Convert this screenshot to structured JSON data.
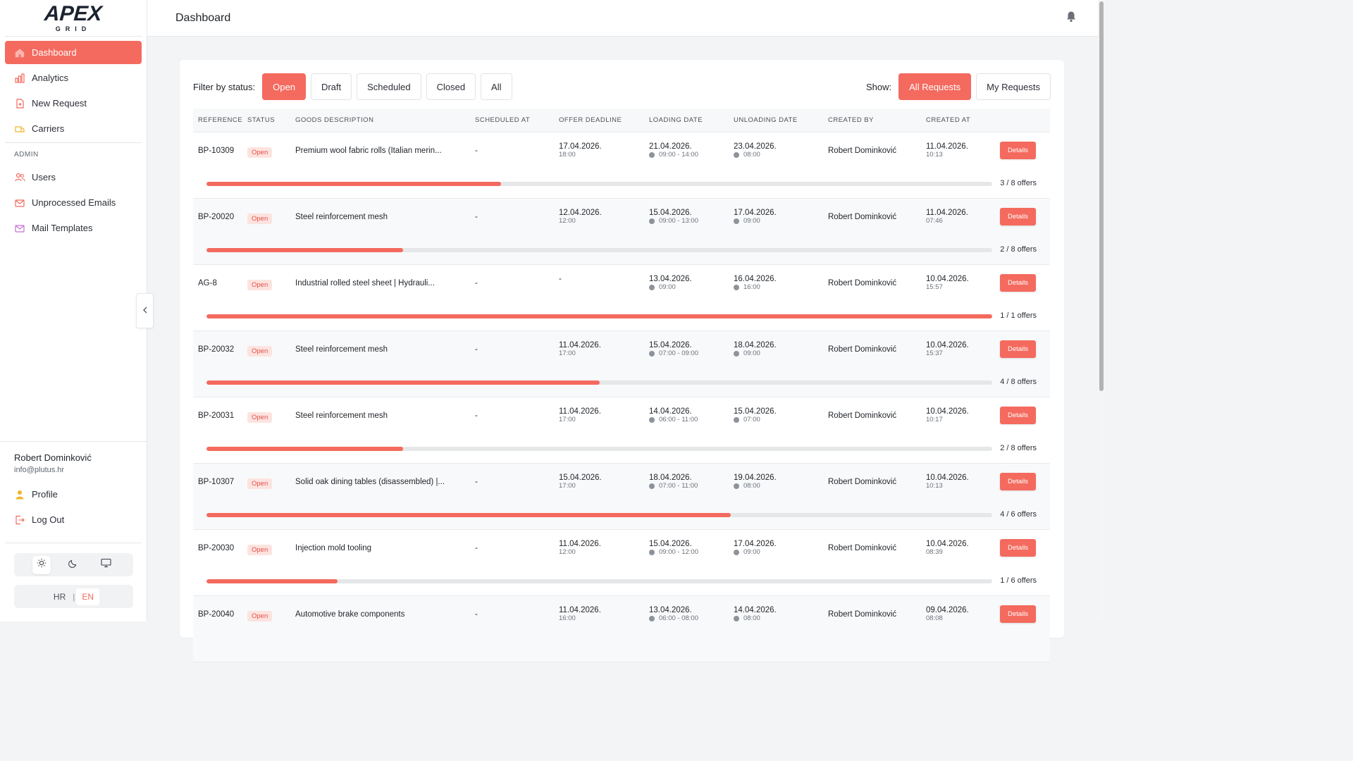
{
  "app": {
    "logo_main": "APEX",
    "logo_sub": "GRID"
  },
  "header": {
    "title": "Dashboard"
  },
  "sidebar": {
    "items": [
      {
        "label": "Dashboard",
        "icon": "home-icon",
        "active": true
      },
      {
        "label": "Analytics",
        "icon": "chart-icon"
      },
      {
        "label": "New Request",
        "icon": "document-plus-icon"
      },
      {
        "label": "Carriers",
        "icon": "truck-icon"
      }
    ],
    "admin_label": "ADMIN",
    "admin_items": [
      {
        "label": "Users",
        "icon": "users-icon"
      },
      {
        "label": "Unprocessed Emails",
        "icon": "mail-icon"
      },
      {
        "label": "Mail Templates",
        "icon": "mail-template-icon"
      }
    ],
    "user": {
      "name": "Robert Dominković",
      "email": "info@plutus.hr"
    },
    "user_items": [
      {
        "label": "Profile",
        "icon": "user-icon"
      },
      {
        "label": "Log Out",
        "icon": "logout-icon"
      }
    ],
    "languages": {
      "hr": "HR",
      "en": "EN",
      "active": "EN"
    }
  },
  "filters": {
    "label": "Filter by status:",
    "options": [
      "Open",
      "Draft",
      "Scheduled",
      "Closed",
      "All"
    ],
    "active": "Open",
    "show_label": "Show:",
    "show_options": [
      "All Requests",
      "My Requests"
    ],
    "show_active": "All Requests"
  },
  "table": {
    "columns": [
      "REFERENCE",
      "STATUS",
      "GOODS DESCRIPTION",
      "SCHEDULED AT",
      "OFFER DEADLINE",
      "LOADING DATE",
      "UNLOADING DATE",
      "CREATED BY",
      "CREATED AT"
    ],
    "details_label": "Details",
    "rows": [
      {
        "ref": "BP-10309",
        "status": "Open",
        "goods": "Premium wool fabric rolls (Italian merin...",
        "scheduled": "-",
        "deadline_date": "17.04.2026.",
        "deadline_time": "18:00",
        "loading_date": "21.04.2026.",
        "loading_time": "09:00 - 14:00",
        "unloading_date": "23.04.2026.",
        "unloading_time": "08:00",
        "created_by": "Robert Dominković",
        "created_date": "11.04.2026.",
        "created_time": "10:13",
        "offers_label": "3 / 8 offers",
        "progress": 0.375
      },
      {
        "ref": "BP-20020",
        "status": "Open",
        "goods": "Steel reinforcement mesh",
        "scheduled": "-",
        "deadline_date": "12.04.2026.",
        "deadline_time": "12:00",
        "loading_date": "15.04.2026.",
        "loading_time": "09:00 - 13:00",
        "unloading_date": "17.04.2026.",
        "unloading_time": "09:00",
        "created_by": "Robert Dominković",
        "created_date": "11.04.2026.",
        "created_time": "07:46",
        "offers_label": "2 / 8 offers",
        "progress": 0.25
      },
      {
        "ref": "AG-8",
        "status": "Open",
        "goods": "Industrial rolled steel sheet | Hydrauli...",
        "scheduled": "-",
        "deadline_date": "-",
        "deadline_time": "",
        "loading_date": "13.04.2026.",
        "loading_time": "09:00",
        "unloading_date": "16.04.2026.",
        "unloading_time": "16:00",
        "created_by": "Robert Dominković",
        "created_date": "10.04.2026.",
        "created_time": "15:57",
        "offers_label": "1 / 1 offers",
        "progress": 1.0
      },
      {
        "ref": "BP-20032",
        "status": "Open",
        "goods": "Steel reinforcement mesh",
        "scheduled": "-",
        "deadline_date": "11.04.2026.",
        "deadline_time": "17:00",
        "loading_date": "15.04.2026.",
        "loading_time": "07:00 - 09:00",
        "unloading_date": "18.04.2026.",
        "unloading_time": "09:00",
        "created_by": "Robert Dominković",
        "created_date": "10.04.2026.",
        "created_time": "15:37",
        "offers_label": "4 / 8 offers",
        "progress": 0.5
      },
      {
        "ref": "BP-20031",
        "status": "Open",
        "goods": "Steel reinforcement mesh",
        "scheduled": "-",
        "deadline_date": "11.04.2026.",
        "deadline_time": "17:00",
        "loading_date": "14.04.2026.",
        "loading_time": "06:00 - 11:00",
        "unloading_date": "15.04.2026.",
        "unloading_time": "07:00",
        "created_by": "Robert Dominković",
        "created_date": "10.04.2026.",
        "created_time": "10:17",
        "offers_label": "2 / 8 offers",
        "progress": 0.25
      },
      {
        "ref": "BP-10307",
        "status": "Open",
        "goods": "Solid oak dining tables (disassembled) |...",
        "scheduled": "-",
        "deadline_date": "15.04.2026.",
        "deadline_time": "17:00",
        "loading_date": "18.04.2026.",
        "loading_time": "07:00 - 11:00",
        "unloading_date": "19.04.2026.",
        "unloading_time": "08:00",
        "created_by": "Robert Dominković",
        "created_date": "10.04.2026.",
        "created_time": "10:13",
        "offers_label": "4 / 6 offers",
        "progress": 0.667
      },
      {
        "ref": "BP-20030",
        "status": "Open",
        "goods": "Injection mold tooling",
        "scheduled": "-",
        "deadline_date": "11.04.2026.",
        "deadline_time": "12:00",
        "loading_date": "15.04.2026.",
        "loading_time": "09:00 - 12:00",
        "unloading_date": "17.04.2026.",
        "unloading_time": "09:00",
        "created_by": "Robert Dominković",
        "created_date": "10.04.2026.",
        "created_time": "08:39",
        "offers_label": "1 / 6 offers",
        "progress": 0.167
      },
      {
        "ref": "BP-20040",
        "status": "Open",
        "goods": "Automotive brake components",
        "scheduled": "-",
        "deadline_date": "11.04.2026.",
        "deadline_time": "16:00",
        "loading_date": "13.04.2026.",
        "loading_time": "06:00 - 08:00",
        "unloading_date": "14.04.2026.",
        "unloading_time": "08:00",
        "created_by": "Robert Dominković",
        "created_date": "09.04.2026.",
        "created_time": "08:08",
        "offers_label": "",
        "progress": 0
      }
    ]
  },
  "colors": {
    "accent": "#f46a5e",
    "status_bg": "#fde3df",
    "status_text": "#e4504a"
  }
}
